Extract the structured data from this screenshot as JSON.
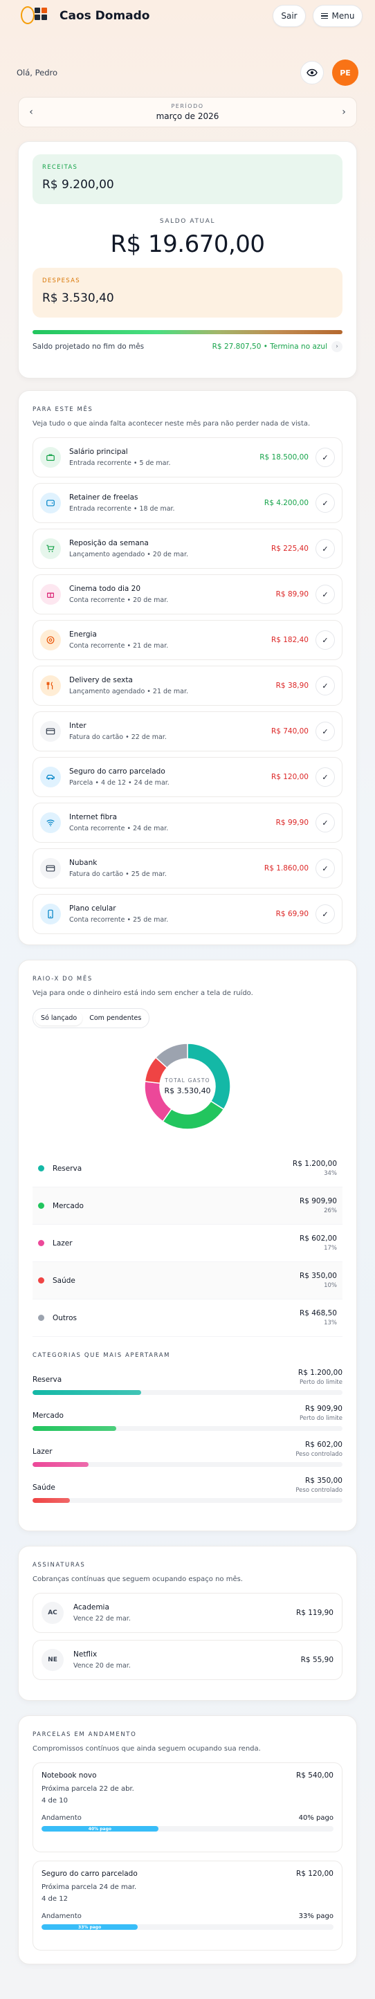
{
  "header": {
    "brand": "Caos Domado",
    "sair": "Sair",
    "menu": "Menu"
  },
  "greeting": "Olá, Pedro",
  "avatar": "PE",
  "period": {
    "label": "PERÍODO",
    "value": "março de 2026"
  },
  "summary": {
    "receitas_label": "RECEITAS",
    "receitas_value": "R$ 9.200,00",
    "saldo_label": "SALDO ATUAL",
    "saldo_value": "R$ 19.670,00",
    "despesas_label": "DESPESAS",
    "despesas_value": "R$ 3.530,40",
    "projection_label": "Saldo projetado no fim do mês",
    "projection_value": "R$ 27.807,50 • Termina no azul"
  },
  "month": {
    "title": "PARA ESTE MÊS",
    "subtitle": "Veja tudo o que ainda falta acontecer neste mês para não perder nada de vista.",
    "items": [
      {
        "title": "Salário principal",
        "sub": "Entrada recorrente • 5 de mar.",
        "value": "R$ 18.500,00",
        "kind": "pos",
        "icon": "briefcase-icon",
        "bg": "#e6f6ec",
        "fg": "#16a34a"
      },
      {
        "title": "Retainer de freelas",
        "sub": "Entrada recorrente • 18 de mar.",
        "value": "R$ 4.200,00",
        "kind": "pos",
        "icon": "wallet-icon",
        "bg": "#e0f2fe",
        "fg": "#0284c7"
      },
      {
        "title": "Reposição da semana",
        "sub": "Lançamento agendado • 20 de mar.",
        "value": "R$ 225,40",
        "kind": "neg",
        "icon": "cart-icon",
        "bg": "#e6f6ec",
        "fg": "#16a34a"
      },
      {
        "title": "Cinema todo dia 20",
        "sub": "Conta recorrente • 20 de mar.",
        "value": "R$ 89,90",
        "kind": "neg",
        "icon": "gift-icon",
        "bg": "#fde7f0",
        "fg": "#db2777"
      },
      {
        "title": "Energia",
        "sub": "Conta recorrente • 21 de mar.",
        "value": "R$ 182,40",
        "kind": "neg",
        "icon": "target-icon",
        "bg": "#ffedd5",
        "fg": "#ea580c"
      },
      {
        "title": "Delivery de sexta",
        "sub": "Lançamento agendado • 21 de mar.",
        "value": "R$ 38,90",
        "kind": "neg",
        "icon": "utensils-icon",
        "bg": "#ffedd5",
        "fg": "#ea580c"
      },
      {
        "title": "Inter",
        "sub": "Fatura do cartão • 22 de mar.",
        "value": "R$ 740,00",
        "kind": "neg",
        "icon": "credit-card-icon",
        "bg": "#f3f4f6",
        "fg": "#374151"
      },
      {
        "title": "Seguro do carro parcelado",
        "sub": "Parcela • 4 de 12 • 24 de mar.",
        "value": "R$ 120,00",
        "kind": "neg",
        "icon": "car-icon",
        "bg": "#e0f2fe",
        "fg": "#0284c7"
      },
      {
        "title": "Internet fibra",
        "sub": "Conta recorrente • 24 de mar.",
        "value": "R$ 99,90",
        "kind": "neg",
        "icon": "wifi-icon",
        "bg": "#e0f2fe",
        "fg": "#0284c7"
      },
      {
        "title": "Nubank",
        "sub": "Fatura do cartão • 25 de mar.",
        "value": "R$ 1.860,00",
        "kind": "neg",
        "icon": "credit-card-icon",
        "bg": "#f3f4f6",
        "fg": "#374151"
      },
      {
        "title": "Plano celular",
        "sub": "Conta recorrente • 25 de mar.",
        "value": "R$ 69,90",
        "kind": "neg",
        "icon": "phone-icon",
        "bg": "#e0f2fe",
        "fg": "#0284c7"
      }
    ]
  },
  "raio": {
    "title": "RAIO-X DO MÊS",
    "subtitle": "Veja para onde o dinheiro está indo sem encher a tela de ruído.",
    "toggle": [
      "Só lançado",
      "Com pendentes"
    ],
    "donut_label": "TOTAL GASTO",
    "donut_value": "R$ 3.530,40",
    "categories_title": "CATEGORIAS QUE MAIS APERTARAM"
  },
  "chart_data": {
    "type": "pie",
    "title": "",
    "total": "R$ 3.530,40",
    "slices": [
      {
        "name": "Reserva",
        "value": 1200.0,
        "amount": "R$ 1.200,00",
        "pct": "34%",
        "color": "#14b8a6"
      },
      {
        "name": "Mercado",
        "value": 909.9,
        "amount": "R$ 909,90",
        "pct": "26%",
        "color": "#22c55e"
      },
      {
        "name": "Lazer",
        "value": 602.0,
        "amount": "R$ 602,00",
        "pct": "17%",
        "color": "#ec4899"
      },
      {
        "name": "Saúde",
        "value": 350.0,
        "amount": "R$ 350,00",
        "pct": "10%",
        "color": "#ef4444"
      },
      {
        "name": "Outros",
        "value": 468.5,
        "amount": "R$ 468,50",
        "pct": "13%",
        "color": "#9ca3af"
      }
    ]
  },
  "top_categories": [
    {
      "name": "Reserva",
      "amount": "R$ 1.200,00",
      "note": "Perto do limite",
      "fill": 0.35,
      "color": "#14b8a6"
    },
    {
      "name": "Mercado",
      "amount": "R$ 909,90",
      "note": "Perto do limite",
      "fill": 0.27,
      "color": "#22c55e"
    },
    {
      "name": "Lazer",
      "amount": "R$ 602,00",
      "note": "Peso controlado",
      "fill": 0.18,
      "color": "#ec4899"
    },
    {
      "name": "Saúde",
      "amount": "R$ 350,00",
      "note": "Peso controlado",
      "fill": 0.12,
      "color": "#ef4444"
    }
  ],
  "assinaturas": {
    "title": "ASSINATURAS",
    "subtitle": "Cobranças contínuas que seguem ocupando espaço no mês.",
    "items": [
      {
        "badge": "AC",
        "name": "Academia",
        "due": "Vence 22 de mar.",
        "value": "R$ 119,90"
      },
      {
        "badge": "NE",
        "name": "Netflix",
        "due": "Vence 20 de mar.",
        "value": "R$ 55,90"
      }
    ]
  },
  "parcelas": {
    "title": "PARCELAS EM ANDAMENTO",
    "subtitle": "Compromissos contínuos que ainda seguem ocupando sua renda.",
    "andamento_label": "Andamento",
    "items": [
      {
        "name": "Notebook novo",
        "value": "R$ 540,00",
        "next": "Próxima parcela 22 de abr.",
        "count": "4 de 10",
        "pct_label": "40% pago",
        "bar_label": "40% pago",
        "fill": 0.4
      },
      {
        "name": "Seguro do carro parcelado",
        "value": "R$ 120,00",
        "next": "Próxima parcela 24 de mar.",
        "count": "4 de 12",
        "pct_label": "33% pago",
        "bar_label": "33% pago",
        "fill": 0.33
      }
    ]
  }
}
